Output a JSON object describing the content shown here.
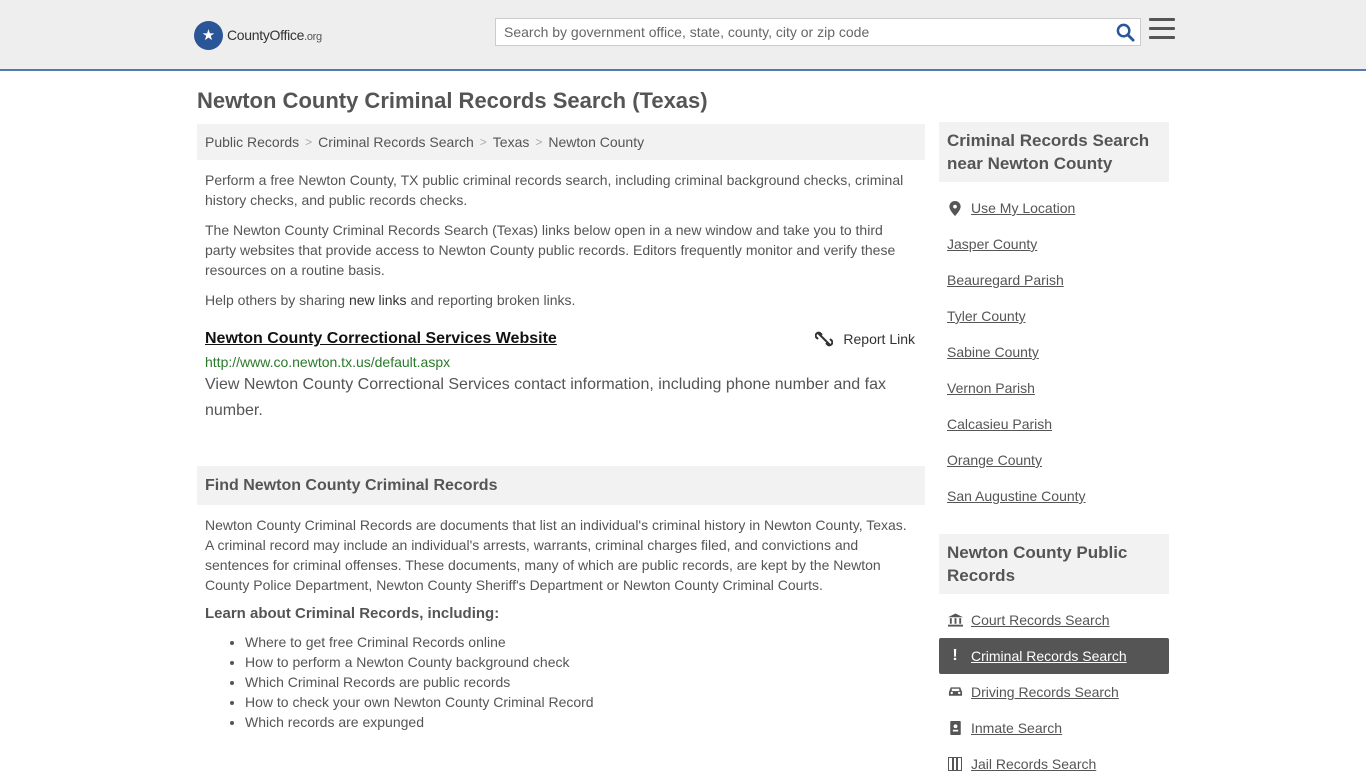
{
  "header": {
    "logo_main": "CountyOffice",
    "logo_suffix": ".org",
    "search_placeholder": "Search by government office, state, county, city or zip code"
  },
  "page_title": "Newton County Criminal Records Search (Texas)",
  "breadcrumb": [
    "Public Records",
    "Criminal Records Search",
    "Texas",
    "Newton County"
  ],
  "intro": {
    "p1": "Perform a free Newton County, TX public criminal records search, including criminal background checks, criminal history checks, and public records checks.",
    "p2": "The Newton County Criminal Records Search (Texas) links below open in a new window and take you to third party websites that provide access to Newton County public records. Editors frequently monitor and verify these resources on a routine basis.",
    "p3_before": "Help others by sharing ",
    "p3_link": "new links",
    "p3_after": " and reporting broken links."
  },
  "links": [
    {
      "title": "Newton County Correctional Services Website",
      "report_label": "Report Link",
      "url": "http://www.co.newton.tx.us/default.aspx",
      "description": "View Newton County Correctional Services contact information, including phone number and fax number."
    }
  ],
  "find_section": {
    "heading": "Find Newton County Criminal Records",
    "body": "Newton County Criminal Records are documents that list an individual's criminal history in Newton County, Texas. A criminal record may include an individual's arrests, warrants, criminal charges filed, and convictions and sentences for criminal offenses. These documents, many of which are public records, are kept by the Newton County Police Department, Newton County Sheriff's Department or Newton County Criminal Courts.",
    "learn_heading": "Learn about Criminal Records, including:",
    "learn_items": [
      "Where to get free Criminal Records online",
      "How to perform a Newton County background check",
      "Which Criminal Records are public records",
      "How to check your own Newton County Criminal Record",
      "Which records are expunged"
    ]
  },
  "sidebar": {
    "nearby_heading": "Criminal Records Search near Newton County",
    "use_location": "Use My Location",
    "nearby": [
      "Jasper County",
      "Beauregard Parish",
      "Tyler County",
      "Sabine County",
      "Vernon Parish",
      "Calcasieu Parish",
      "Orange County",
      "San Augustine County"
    ],
    "public_heading": "Newton County Public Records",
    "public_items": [
      {
        "label": "Court Records Search",
        "icon": "courthouse-icon",
        "active": false
      },
      {
        "label": "Criminal Records Search",
        "icon": "exclamation-icon",
        "active": true
      },
      {
        "label": "Driving Records Search",
        "icon": "car-icon",
        "active": false
      },
      {
        "label": "Inmate Search",
        "icon": "id-badge-icon",
        "active": false
      },
      {
        "label": "Jail Records Search",
        "icon": "jail-icon",
        "active": false
      }
    ]
  }
}
